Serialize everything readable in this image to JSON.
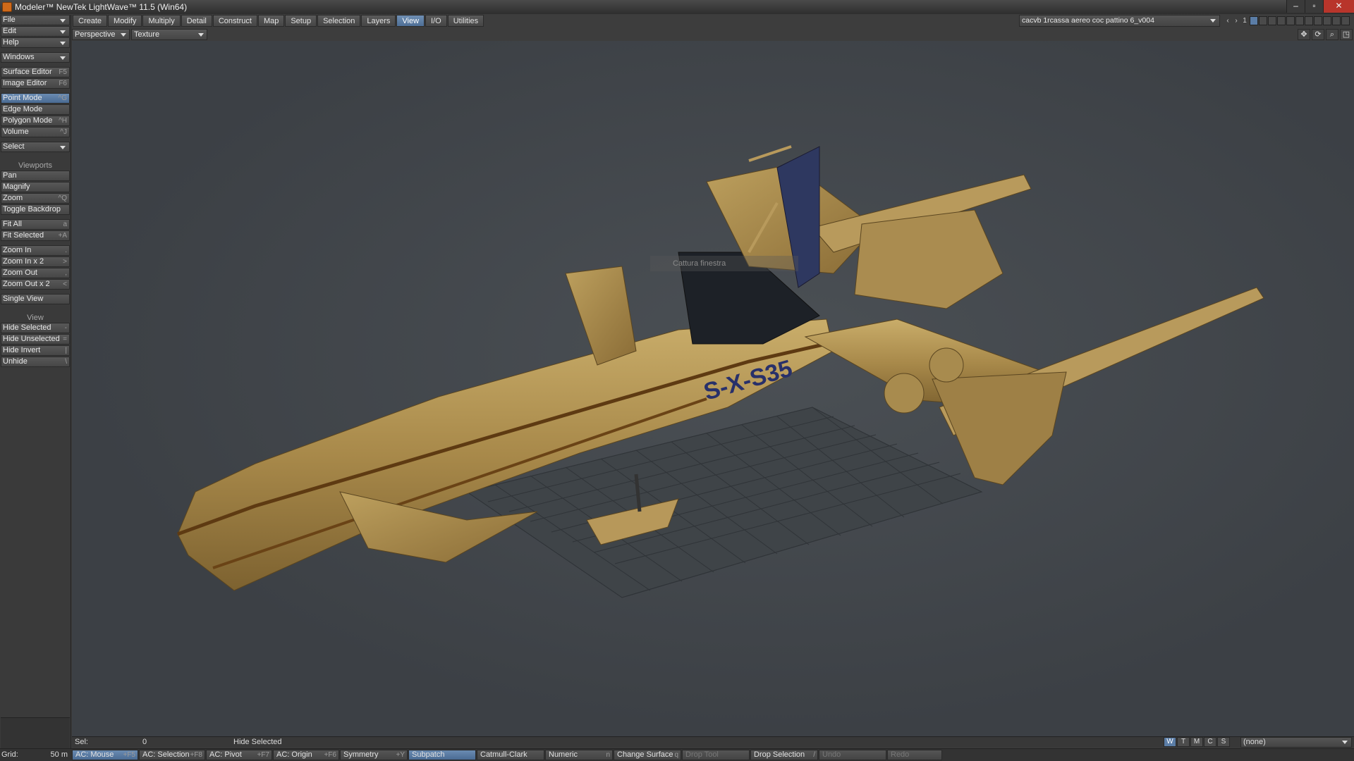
{
  "window": {
    "title": "Modeler™ NewTek LightWave™ 11.5 (Win64)"
  },
  "sidebar": {
    "menus": [
      "File",
      "Edit",
      "Help",
      "Windows"
    ],
    "editors": [
      {
        "label": "Surface Editor",
        "key": "F5"
      },
      {
        "label": "Image Editor",
        "key": "F6"
      }
    ],
    "modes": [
      {
        "label": "Point Mode",
        "key": "^G"
      },
      {
        "label": "Edge Mode",
        "key": ""
      },
      {
        "label": "Polygon Mode",
        "key": "^H"
      },
      {
        "label": "Volume",
        "key": "^J"
      }
    ],
    "select": "Select",
    "viewports_header": "Viewports",
    "viewport_tools": [
      {
        "label": "Pan",
        "key": ""
      },
      {
        "label": "Magnify",
        "key": ""
      },
      {
        "label": "Zoom",
        "key": "^Q"
      },
      {
        "label": "Toggle Backdrop",
        "key": ""
      }
    ],
    "fit": [
      {
        "label": "Fit All",
        "key": "a"
      },
      {
        "label": "Fit Selected",
        "key": "+A"
      }
    ],
    "zoom": [
      {
        "label": "Zoom In",
        "key": "."
      },
      {
        "label": "Zoom In x 2",
        "key": ">"
      },
      {
        "label": "Zoom Out",
        "key": ","
      },
      {
        "label": "Zoom Out x 2",
        "key": "<"
      }
    ],
    "single_view": "Single View",
    "view_header": "View",
    "view_items": [
      {
        "label": "Hide Selected",
        "key": "-"
      },
      {
        "label": "Hide Unselected",
        "key": "="
      },
      {
        "label": "Hide Invert",
        "key": "|"
      },
      {
        "label": "Unhide",
        "key": "\\"
      }
    ]
  },
  "menubar": {
    "tabs": [
      "Create",
      "Modify",
      "Multiply",
      "Detail",
      "Construct",
      "Map",
      "Setup",
      "Selection",
      "Layers",
      "View",
      "I/O",
      "Utilities"
    ],
    "active": "View"
  },
  "viewbar": {
    "projection": "Perspective",
    "render_mode": "Texture"
  },
  "layer": {
    "name": "cacvb 1rcassa aereo  coc pattino 6_v004",
    "number": "1"
  },
  "viewport": {
    "model_label": "S-X-S35",
    "capture_tooltip": "Cattura finestra"
  },
  "status": {
    "sel_label": "Sel:",
    "sel_value": "0",
    "message": "Hide Selected",
    "wtmcs": [
      "W",
      "T",
      "M",
      "C",
      "S"
    ],
    "vmap": "(none)",
    "grid_label": "Grid:",
    "grid_value": "50 m"
  },
  "bottombar": [
    {
      "label": "AC: Mouse",
      "key": "+F5",
      "state": "on"
    },
    {
      "label": "AC: Selection",
      "key": "+F8",
      "state": ""
    },
    {
      "label": "AC: Pivot",
      "key": "+F7",
      "state": ""
    },
    {
      "label": "AC: Origin",
      "key": "+F6",
      "state": ""
    },
    {
      "label": "Symmetry",
      "key": "+Y",
      "state": ""
    },
    {
      "label": "Subpatch",
      "key": "",
      "state": "on"
    },
    {
      "label": "Catmull-Clark",
      "key": "",
      "state": ""
    },
    {
      "label": "Numeric",
      "key": "n",
      "state": ""
    },
    {
      "label": "Change Surface",
      "key": "q",
      "state": ""
    },
    {
      "label": "Drop Tool",
      "key": "",
      "state": "dim"
    },
    {
      "label": "Drop Selection",
      "key": "/",
      "state": ""
    },
    {
      "label": "Undo",
      "key": "",
      "state": "dim"
    },
    {
      "label": "Redo",
      "key": "",
      "state": "dim"
    }
  ]
}
